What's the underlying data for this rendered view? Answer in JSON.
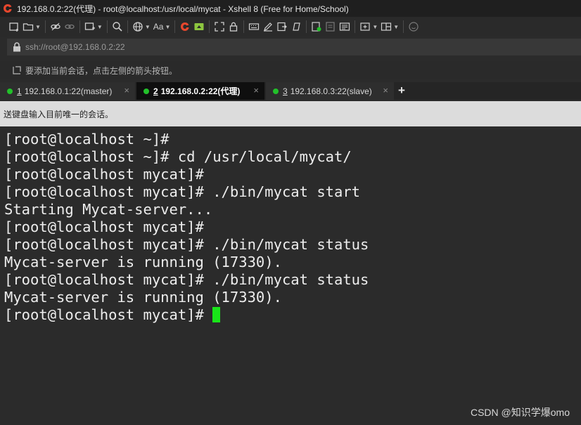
{
  "window": {
    "title": "192.168.0.2:22(代理) - root@localhost:/usr/local/mycat - Xshell 8 (Free for Home/School)"
  },
  "toolbar": {
    "font_label": "Aa",
    "icons": [
      "new-session-icon",
      "open-folder-icon",
      "reconnect-icon",
      "disconnect-icon",
      "new-tab-icon",
      "search-icon",
      "globe-icon",
      "font-icon",
      "xshell-logo-icon",
      "xftp-icon",
      "fullscreen-icon",
      "lock-icon",
      "keyboard-icon",
      "highlight-icon",
      "script-icon",
      "macro-icon",
      "compose-icon",
      "compose-bar-icon",
      "quick-commands-icon",
      "new-group-icon",
      "layout-icon",
      "help-icon"
    ]
  },
  "address": {
    "value": "ssh://root@192.168.0.2:22"
  },
  "hint": {
    "text": "要添加当前会话，点击左侧的箭头按钮。"
  },
  "tabs": [
    {
      "num": "1",
      "label": "192.168.0.1:22(master)",
      "active": false
    },
    {
      "num": "2",
      "label": "192.168.0.2:22(代理)",
      "active": true
    },
    {
      "num": "3",
      "label": "192.168.0.3:22(slave)",
      "active": false
    }
  ],
  "tab_add_label": "+",
  "tab_close_label": "×",
  "sendbar": {
    "text": "送键盘输入目前唯一的会话。"
  },
  "terminal": {
    "lines": [
      "[root@localhost ~]#",
      "[root@localhost ~]# cd /usr/local/mycat/",
      "[root@localhost mycat]#",
      "[root@localhost mycat]# ./bin/mycat start",
      "Starting Mycat-server...",
      "[root@localhost mycat]#",
      "[root@localhost mycat]# ./bin/mycat status",
      "Mycat-server is running (17330).",
      "[root@localhost mycat]# ./bin/mycat status",
      "Mycat-server is running (17330).",
      "[root@localhost mycat]# "
    ],
    "cursor_color": "#19e619"
  },
  "watermark": "CSDN @知识学爆omo",
  "colors": {
    "titlebar_bg": "#1f1f1f",
    "terminal_bg": "#2b2b2b",
    "terminal_fg": "#ededed",
    "tab_active_bg": "#0f0f0f",
    "status_dot": "#22c12a",
    "sendbar_bg": "#dcdcdc"
  }
}
